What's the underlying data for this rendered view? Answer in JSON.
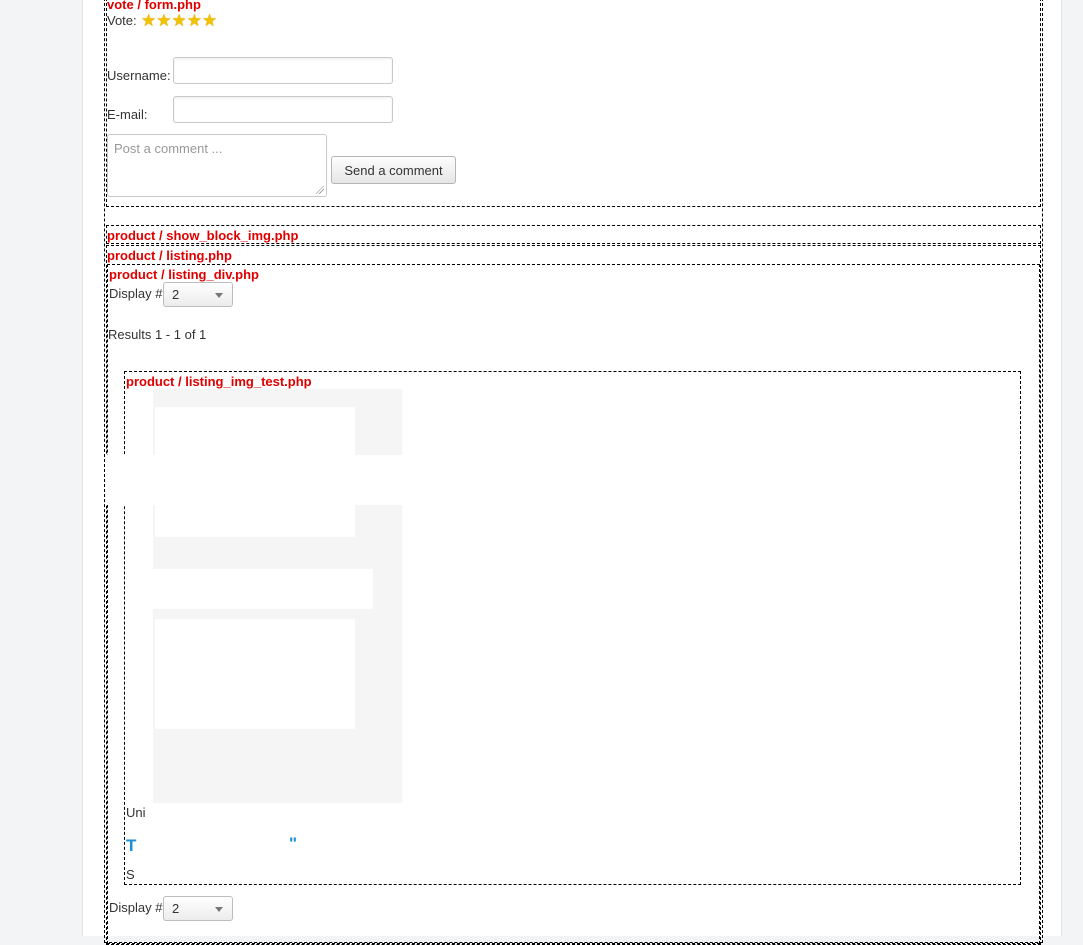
{
  "templates": {
    "vote_form": "vote / form.php",
    "show_block_img": "product / show_block_img.php",
    "listing": "product / listing.php",
    "listing_div": "product / listing_div.php",
    "listing_img_test": "product / listing_img_test.php"
  },
  "vote": {
    "label": "Vote:",
    "stars": 5
  },
  "comment_form": {
    "username_label": "Username:",
    "email_label": "E-mail:",
    "comment_placeholder": "Post a comment ...",
    "send_label": "Send a comment"
  },
  "listing": {
    "display_label": "Display #",
    "display_value": "2",
    "results_text": "Results 1 - 1 of 1",
    "display_label_bottom": "Display #",
    "display_value_bottom": "2"
  },
  "product": {
    "category_fragment": "Uni",
    "title_fragment_start": "T",
    "title_fragment_end": "\"",
    "desc_fragment": "S"
  },
  "colors": {
    "template_label": "#e00000",
    "link": "#1a8fd6",
    "star": "#f2c200"
  }
}
